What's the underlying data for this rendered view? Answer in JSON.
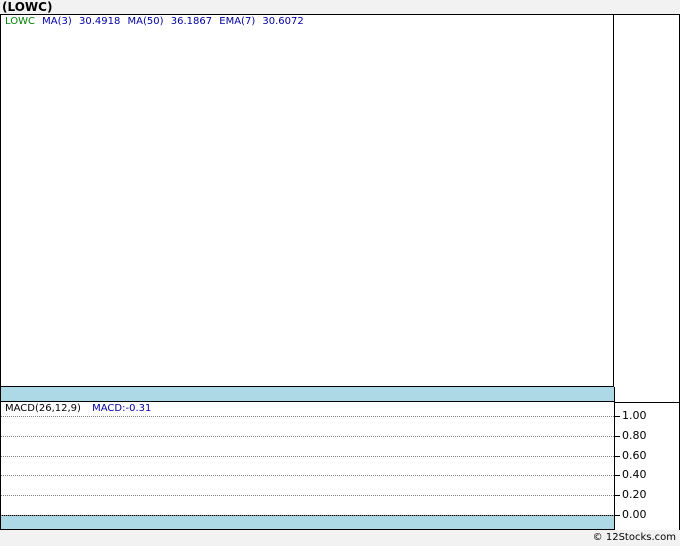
{
  "title": "(LOWC)",
  "legend": {
    "symbol": "LOWC",
    "ma3_label": "MA(3)",
    "ma3_value": "30.4918",
    "ma50_label": "MA(50)",
    "ma50_value": "36.1867",
    "ema7_label": "EMA(7)",
    "ema7_value": "30.6072"
  },
  "macd_legend": {
    "name": "MACD(26,12,9)",
    "value": "MACD:-0.31"
  },
  "chart_data": {
    "type": "line",
    "title": "(LOWC)",
    "panels": [
      {
        "name": "price",
        "series": [
          {
            "name": "MA(3)",
            "last_value": 30.4918
          },
          {
            "name": "MA(50)",
            "last_value": 36.1867
          },
          {
            "name": "EMA(7)",
            "last_value": 30.6072
          }
        ]
      },
      {
        "name": "MACD(26,12,9)",
        "series": [
          {
            "name": "MACD",
            "last_value": -0.31
          }
        ],
        "yticks": [
          "1.00",
          "0.80",
          "0.60",
          "0.40",
          "0.20",
          "0.00"
        ],
        "ylim": [
          0,
          1
        ],
        "grid": true
      }
    ]
  },
  "footer": "© 12Stocks.com"
}
